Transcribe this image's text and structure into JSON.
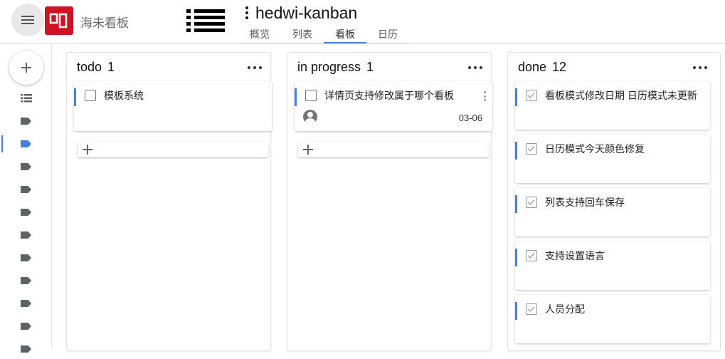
{
  "header": {
    "app_name": "海未看板",
    "project_title": "hedwi-kanban",
    "tabs": [
      {
        "label": "概览"
      },
      {
        "label": "列表"
      },
      {
        "label": "看板",
        "active": true
      },
      {
        "label": "日历"
      }
    ]
  },
  "icons": {
    "menu": "hamburger-icon",
    "logo": "app-logo-icon",
    "list": "list-view-icon",
    "project_menu": "more-vert-icon",
    "add": "plus-icon",
    "sidebar_list": "list-icon",
    "sidebar_tag": "label-icon"
  },
  "colors": {
    "accent": "#4a7fd6",
    "logo_red": "#cf1322"
  },
  "columns": [
    {
      "title": "todo",
      "count": "1",
      "cards": [
        {
          "text": "模板系统",
          "checked": false
        }
      ],
      "has_add": true
    },
    {
      "title": "in progress",
      "count": "1",
      "cards": [
        {
          "text": "详情页支持修改属于哪个看板",
          "checked": false,
          "date": "03-06",
          "has_avatar": true
        }
      ],
      "has_add": true
    },
    {
      "title": "done",
      "count": "12",
      "cards": [
        {
          "text": "看板模式修改日期 日历模式未更新",
          "checked": true
        },
        {
          "text": "日历模式今天颜色修复",
          "checked": true
        },
        {
          "text": "列表支持回车保存",
          "checked": true
        },
        {
          "text": "支持设置语言",
          "checked": true
        },
        {
          "text": "人员分配",
          "checked": true
        }
      ],
      "has_add": false
    }
  ]
}
